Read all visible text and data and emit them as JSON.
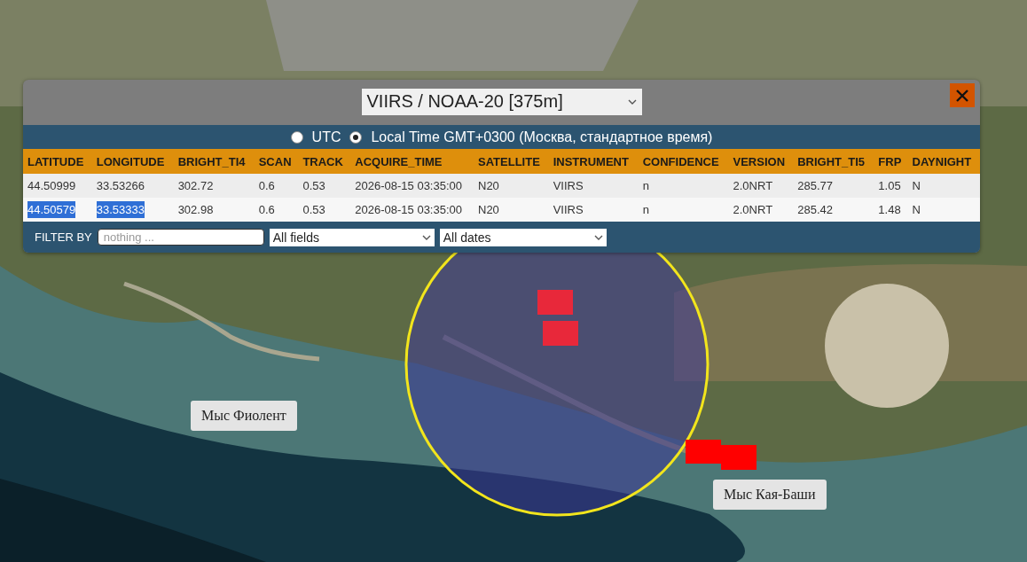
{
  "panel": {
    "source_select": {
      "value": "VIIRS / NOAA-20 [375m]"
    },
    "time_options": [
      {
        "label": "UTC",
        "selected": false
      },
      {
        "label": "Local Time GMT+0300 (Москва, стандартное время)",
        "selected": true
      }
    ],
    "table": {
      "columns": [
        "LATITUDE",
        "LONGITUDE",
        "BRIGHT_TI4",
        "SCAN",
        "TRACK",
        "ACQUIRE_TIME",
        "SATELLITE",
        "INSTRUMENT",
        "CONFIDENCE",
        "VERSION",
        "BRIGHT_TI5",
        "FRP",
        "DAYNIGHT"
      ],
      "rows": [
        {
          "cells": [
            {
              "text": "44.50999",
              "highlighted": false
            },
            {
              "text": "33.53266",
              "highlighted": false
            },
            {
              "text": "302.72",
              "highlighted": false
            },
            {
              "text": "0.6",
              "highlighted": false
            },
            {
              "text": "0.53",
              "highlighted": false
            },
            {
              "text": "2026-08-15 03:35:00",
              "highlighted": false
            },
            {
              "text": "N20",
              "highlighted": false
            },
            {
              "text": "VIIRS",
              "highlighted": false
            },
            {
              "text": "n",
              "highlighted": false
            },
            {
              "text": "2.0NRT",
              "highlighted": false
            },
            {
              "text": "285.77",
              "highlighted": false
            },
            {
              "text": "1.05",
              "highlighted": false
            },
            {
              "text": "N",
              "highlighted": false
            }
          ]
        },
        {
          "cells": [
            {
              "text": "44.50579",
              "highlighted": true
            },
            {
              "text": "33.53333",
              "highlighted": true
            },
            {
              "text": "302.98",
              "highlighted": false
            },
            {
              "text": "0.6",
              "highlighted": false
            },
            {
              "text": "0.53",
              "highlighted": false
            },
            {
              "text": "2026-08-15 03:35:00",
              "highlighted": false
            },
            {
              "text": "N20",
              "highlighted": false
            },
            {
              "text": "VIIRS",
              "highlighted": false
            },
            {
              "text": "n",
              "highlighted": false
            },
            {
              "text": "2.0NRT",
              "highlighted": false
            },
            {
              "text": "285.42",
              "highlighted": false
            },
            {
              "text": "1.48",
              "highlighted": false
            },
            {
              "text": "N",
              "highlighted": false
            }
          ]
        }
      ]
    },
    "filter": {
      "label": "FILTER BY",
      "search": {
        "placeholder": "nothing ..."
      },
      "field_select": {
        "value": "All fields"
      },
      "date_select": {
        "value": "All dates"
      }
    }
  },
  "map": {
    "labels": [
      "Мыс Фиолент",
      "Мыс Кая-Баши"
    ]
  }
}
